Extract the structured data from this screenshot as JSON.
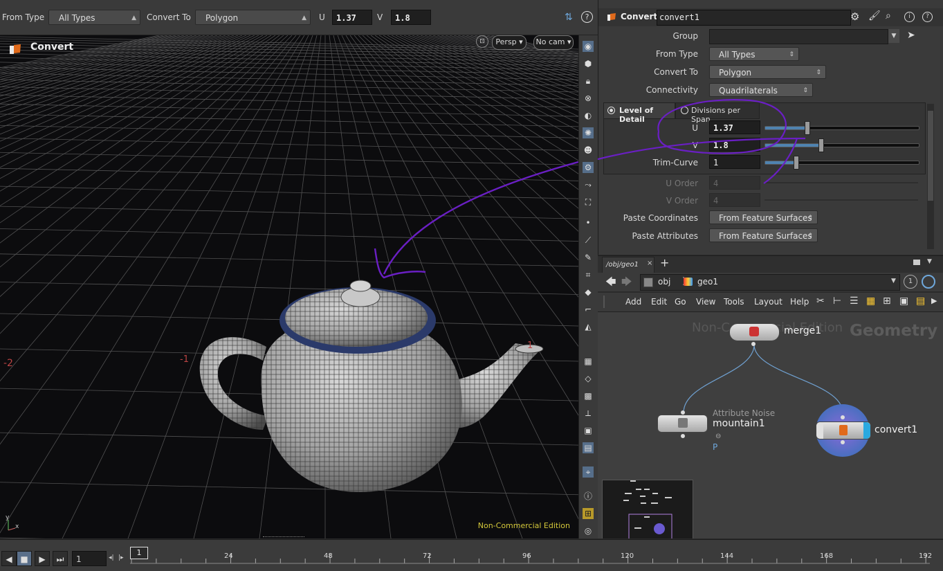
{
  "toolbar": {
    "from_type_label": "From Type",
    "from_type_value": "All Types",
    "convert_to_label": "Convert To",
    "convert_to_value": "Polygon",
    "u_label": "U",
    "u_value": "1.37",
    "v_label": "V",
    "v_value": "1.8"
  },
  "viewport": {
    "title": "Convert",
    "persp_label": "Persp",
    "cam_label": "No cam",
    "watermark": "Non-Commercial Edition",
    "grid_labels": [
      "-2",
      "-1",
      "1"
    ],
    "axis_x": "x",
    "axis_y": "y"
  },
  "params": {
    "node_type": "Convert",
    "node_name": "convert1",
    "group_label": "Group",
    "group_value": "",
    "from_type_label": "From Type",
    "from_type_value": "All Types",
    "convert_to_label": "Convert To",
    "convert_to_value": "Polygon",
    "connectivity_label": "Connectivity",
    "connectivity_value": "Quadrilaterals",
    "lod_tab": "Level of Detail",
    "dps_tab": "Divisions per Span",
    "u_label": "U",
    "u_value": "1.37",
    "u_fraction": 0.27,
    "v_label": "V",
    "v_value": "1.8",
    "v_fraction": 0.36,
    "trim_label": "Trim-Curve",
    "trim_value": "1",
    "trim_fraction": 0.2,
    "uorder_label": "U Order",
    "uorder_value": "4",
    "vorder_label": "V Order",
    "vorder_value": "4",
    "paste_coords_label": "Paste Coordinates",
    "paste_coords_value": "From Feature Surfaces",
    "paste_attrs_label": "Paste Attributes",
    "paste_attrs_value": "From Feature Surfaces"
  },
  "network": {
    "tab_label": "/obj/geo1",
    "path_obj": "obj",
    "path_geo": "geo1",
    "page_indicator": "1",
    "menu": [
      "Add",
      "Edit",
      "Go",
      "View",
      "Tools",
      "Layout",
      "Help"
    ],
    "watermark": "Non-Commercial Edition",
    "context_label": "Geometry",
    "nodes": {
      "merge": "merge1",
      "mountain_type": "Attribute Noise",
      "mountain": "mountain1",
      "mountain_flag": "P",
      "convert": "convert1"
    }
  },
  "timeline": {
    "current_frame": "1",
    "frame_marker": "1",
    "ticks": [
      "24",
      "48",
      "72",
      "96",
      "120",
      "144",
      "168",
      "192"
    ]
  },
  "colors": {
    "annotation": "#6a1fc4",
    "slider_fill": "#4f83b0",
    "watermark": "#d4c83a"
  }
}
